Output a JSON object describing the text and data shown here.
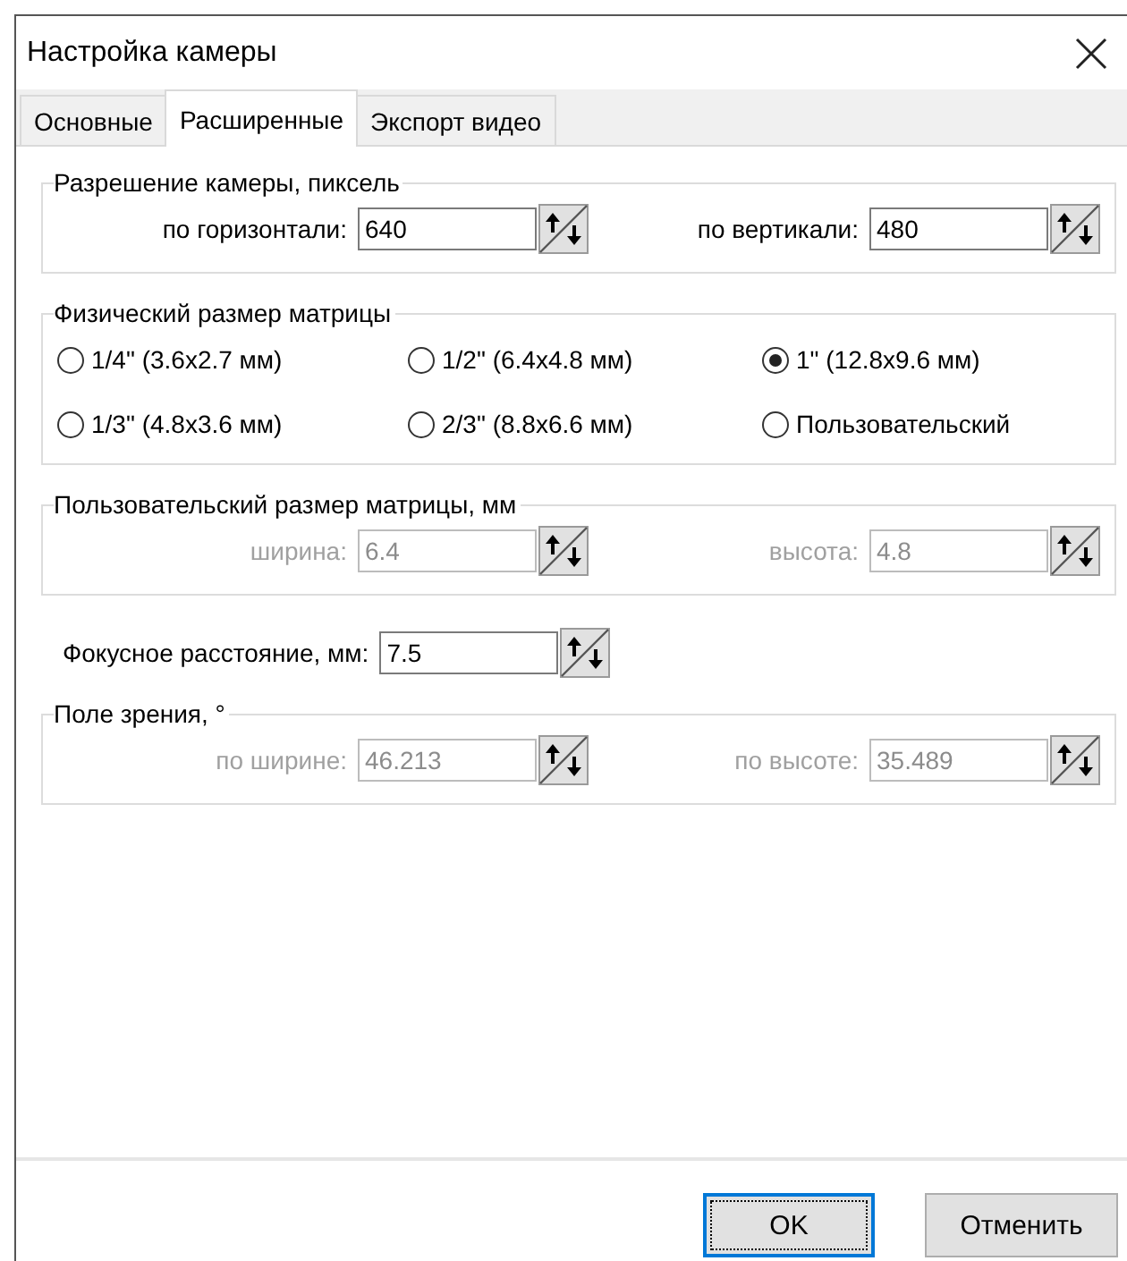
{
  "window": {
    "title": "Настройка камеры"
  },
  "tabs": [
    {
      "label": "Основные",
      "selected": false
    },
    {
      "label": "Расширенные",
      "selected": true
    },
    {
      "label": "Экспорт видео",
      "selected": false
    }
  ],
  "resolution": {
    "title": "Разрешение камеры, пиксель",
    "fields": [
      {
        "label": "по горизонтали:",
        "value": "640",
        "disabled": false
      },
      {
        "label": "по вертикали:",
        "value": "480",
        "disabled": false
      }
    ]
  },
  "sensor_size": {
    "title": "Физический размер матрицы",
    "options": [
      {
        "label": "1/4\" (3.6x2.7 мм)",
        "selected": false
      },
      {
        "label": "1/2\" (6.4x4.8 мм)",
        "selected": false
      },
      {
        "label": "1\" (12.8x9.6 мм)",
        "selected": true
      },
      {
        "label": "1/3\" (4.8x3.6 мм)",
        "selected": false
      },
      {
        "label": "2/3\" (8.8x6.6 мм)",
        "selected": false
      },
      {
        "label": "Пользовательский",
        "selected": false
      }
    ]
  },
  "custom_size": {
    "title": "Пользовательский размер матрицы, мм",
    "fields": [
      {
        "label": "ширина:",
        "value": "6.4",
        "disabled": true
      },
      {
        "label": "высота:",
        "value": "4.8",
        "disabled": true
      }
    ]
  },
  "focal_length": {
    "label": "Фокусное расстояние, мм:",
    "value": "7.5",
    "disabled": false
  },
  "field_of_view": {
    "title": "Поле зрения, °",
    "fields": [
      {
        "label": "по ширине:",
        "value": "46.213",
        "disabled": true
      },
      {
        "label": "по высоте:",
        "value": "35.489",
        "disabled": true
      }
    ]
  },
  "buttons": [
    {
      "label": "OK",
      "default": true
    },
    {
      "label": "Отменить",
      "default": false
    }
  ]
}
